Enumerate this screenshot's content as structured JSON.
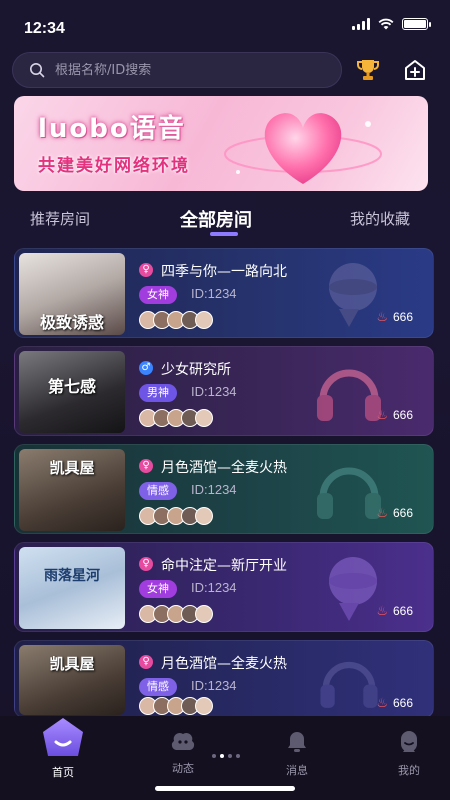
{
  "status_bar": {
    "time": "12:34"
  },
  "search": {
    "placeholder": "根据名称/ID搜索"
  },
  "banner": {
    "title": "luobo语音",
    "subtitle": "共建美好网络环境"
  },
  "tabs": [
    {
      "label": "推荐房间",
      "active": false
    },
    {
      "label": "全部房间",
      "active": true
    },
    {
      "label": "我的收藏",
      "active": false
    }
  ],
  "rooms": [
    {
      "name": "四季与你—一路向北",
      "tag": "女神",
      "id": "ID:1234",
      "heat": "666",
      "gender": "female",
      "cover_text": "极致诱惑",
      "bg": "blue"
    },
    {
      "name": "少女研究所",
      "tag": "男神",
      "id": "ID:1234",
      "heat": "666",
      "gender": "male",
      "cover_text": "第七感",
      "bg": "purple"
    },
    {
      "name": "月色酒馆—全麦火热",
      "tag": "情感",
      "id": "ID:1234",
      "heat": "666",
      "gender": "female",
      "cover_text": "凯具屋",
      "bg": "teal"
    },
    {
      "name": "命中注定—新厅开业",
      "tag": "女神",
      "id": "ID:1234",
      "heat": "666",
      "gender": "female",
      "cover_text": "雨落星河",
      "bg": "violet"
    },
    {
      "name": "月色酒馆—全麦火热",
      "tag": "情感",
      "id": "ID:1234",
      "heat": "666",
      "gender": "female",
      "cover_text": "凯具屋",
      "bg": "indigo"
    }
  ],
  "nav": [
    {
      "label": "首页",
      "active": true
    },
    {
      "label": "动态",
      "active": false
    },
    {
      "label": "消息",
      "active": false
    },
    {
      "label": "我的",
      "active": false
    }
  ],
  "colors": {
    "accent": "#8d7bff",
    "tag_female": "#a13dde",
    "tag_male": "#6f55e6",
    "tag_emotion": "#7f61e8",
    "heat": "#ff5a5a"
  }
}
